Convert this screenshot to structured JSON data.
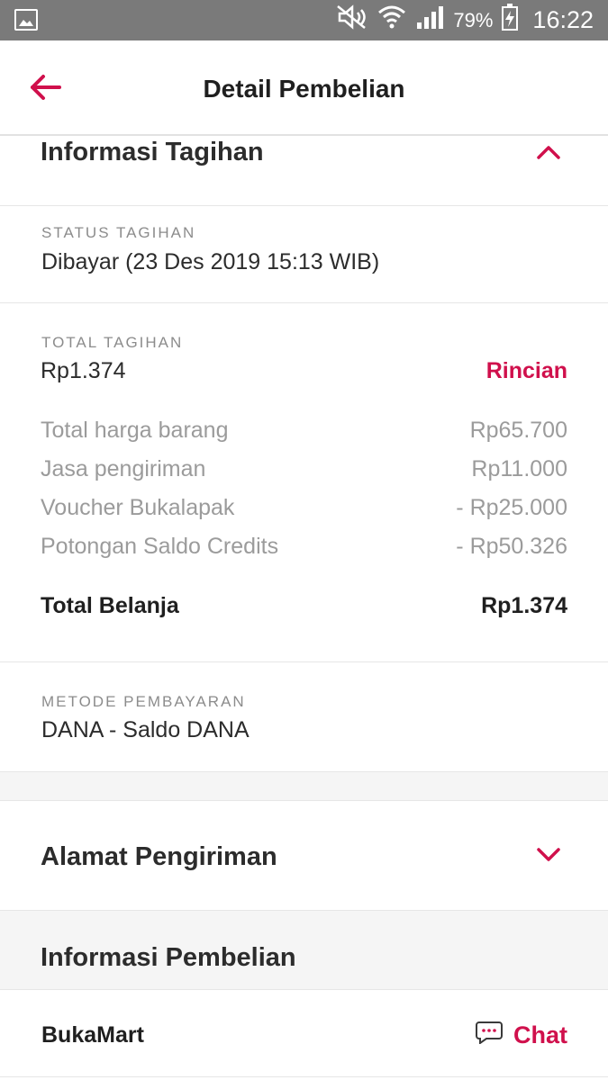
{
  "status_bar": {
    "battery": "79%",
    "time": "16:22",
    "icons": [
      "gallery-icon",
      "mute-icon",
      "wifi-icon",
      "signal-icon",
      "battery-charging-icon"
    ]
  },
  "app_bar": {
    "title": "Detail Pembelian",
    "back_icon": "back-arrow-icon"
  },
  "billing": {
    "section_title": "Informasi Tagihan",
    "status_label": "STATUS TAGIHAN",
    "status_value": "Dibayar (23 Des 2019 15:13 WIB)",
    "total_label": "TOTAL TAGIHAN",
    "total_value": "Rp1.374",
    "details_link": "Rincian",
    "items": [
      {
        "label": "Total harga barang",
        "value": "Rp65.700"
      },
      {
        "label": "Jasa pengiriman",
        "value": "Rp11.000"
      },
      {
        "label": "Voucher Bukalapak",
        "value": "- Rp25.000"
      },
      {
        "label": "Potongan Saldo Credits",
        "value": "- Rp50.326"
      }
    ],
    "grand_total_label": "Total Belanja",
    "grand_total_value": "Rp1.374",
    "payment_label": "METODE PEMBAYARAN",
    "payment_value": "DANA - Saldo DANA"
  },
  "shipping": {
    "section_title": "Alamat Pengiriman"
  },
  "purchase": {
    "section_title": "Informasi Pembelian",
    "seller": "BukaMart",
    "chat_label": "Chat"
  },
  "colors": {
    "accent": "#d0104c",
    "status_bar": "#7a7a7a"
  }
}
